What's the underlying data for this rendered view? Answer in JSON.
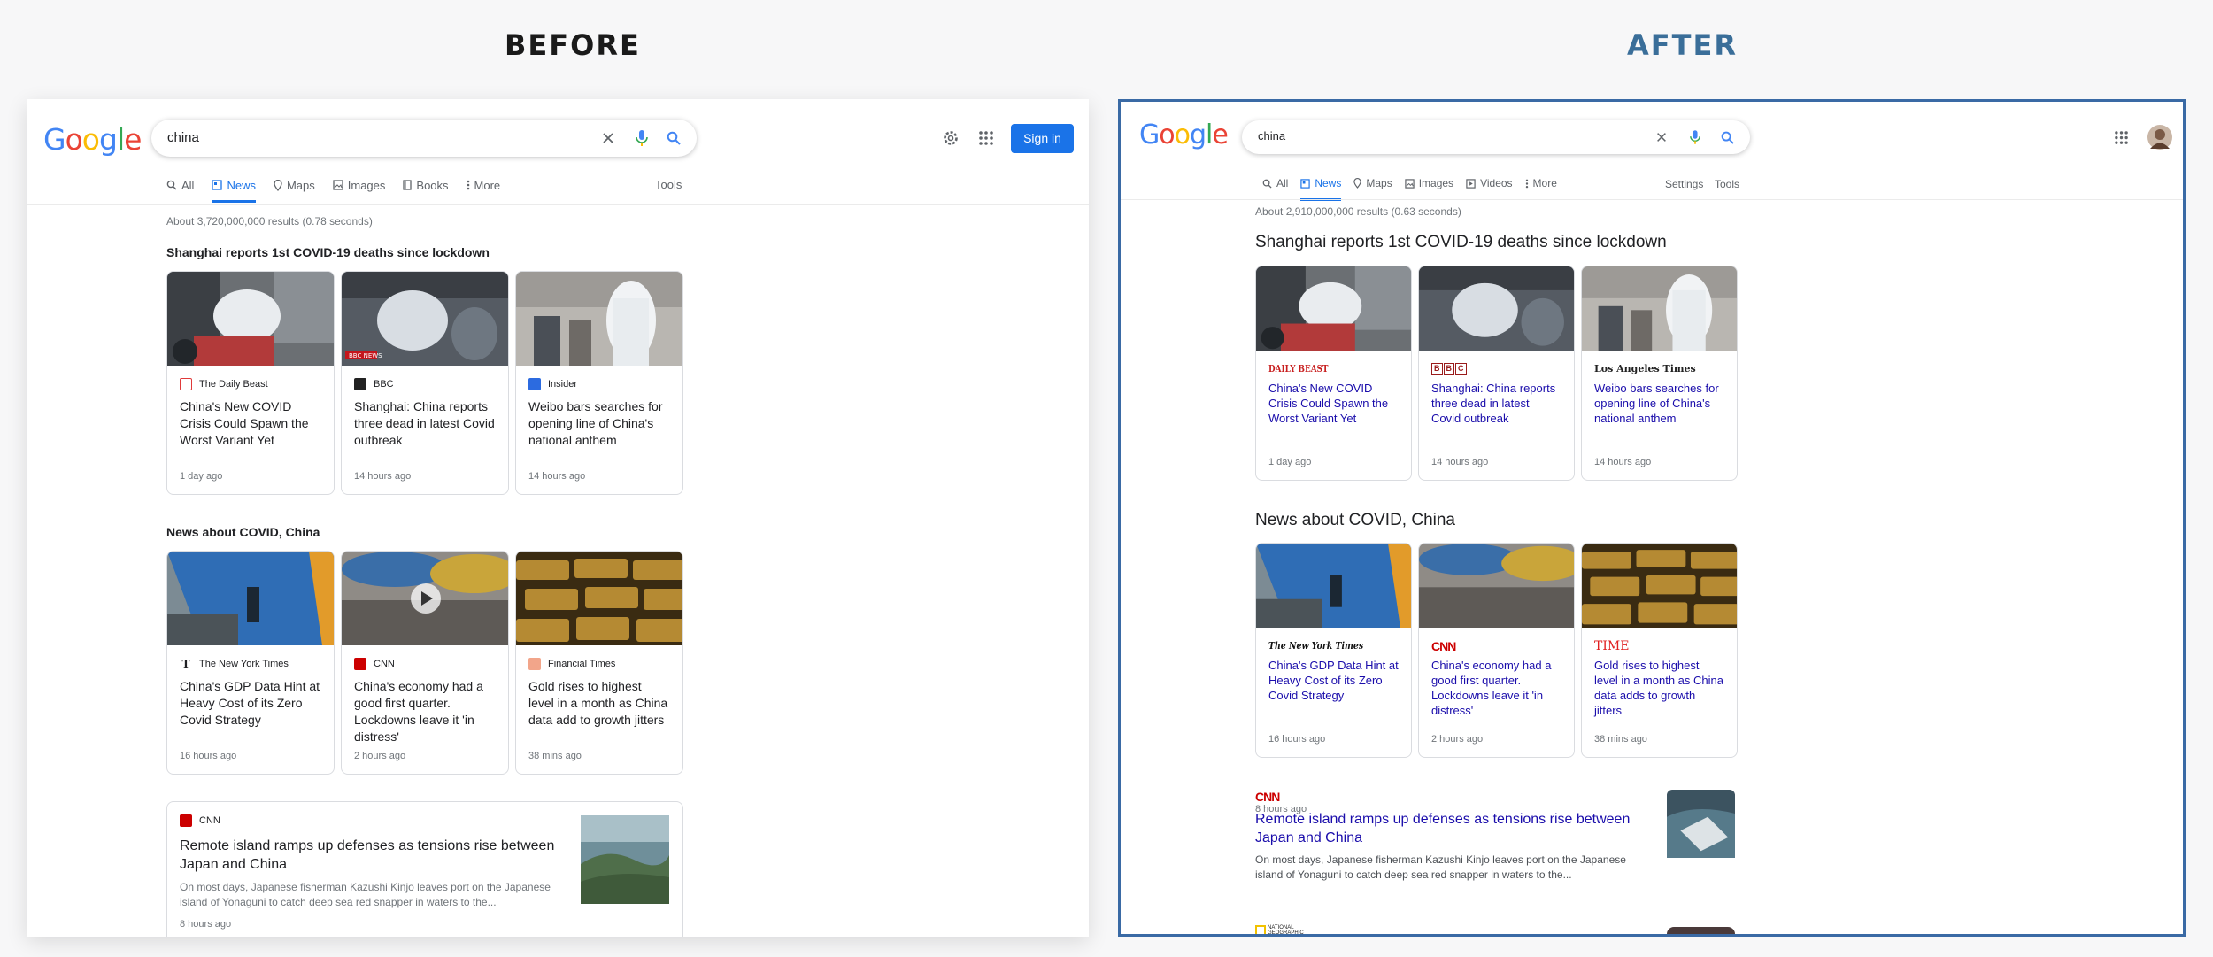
{
  "headings": {
    "before": "BEFORE",
    "after": "AFTER"
  },
  "before": {
    "logo": "Google",
    "query": "china",
    "tabs": [
      "All",
      "News",
      "Maps",
      "Images",
      "Books",
      "More"
    ],
    "tools": "Tools",
    "sign_in": "Sign in",
    "result_stats": "About 3,720,000,000 results (0.78 seconds)",
    "section1_title": "Shanghai reports 1st COVID-19 deaths since lockdown",
    "section1": [
      {
        "source": "The Daily Beast",
        "title": "China's New COVID Crisis Could Spawn the Worst Variant Yet",
        "time": "1 day ago",
        "fav_color": "#e03a3a"
      },
      {
        "source": "BBC",
        "title": "Shanghai: China reports three dead in latest Covid outbreak",
        "time": "14 hours ago",
        "fav_color": "#222222",
        "img_label": "BBC NEWS"
      },
      {
        "source": "Insider",
        "title": "Weibo bars searches for opening line of China's national anthem",
        "time": "14 hours ago",
        "fav_color": "#2c6be0"
      }
    ],
    "section2_title": "News about COVID, China",
    "section2": [
      {
        "source": "The New York Times",
        "title": "China's GDP Data Hint at Heavy Cost of its Zero Covid Strategy",
        "time": "16 hours ago",
        "fav_color": "#222222"
      },
      {
        "source": "CNN",
        "title": "China's economy had a good first quarter. Lockdowns leave it 'in distress'",
        "time": "2 hours ago",
        "fav_color": "#cc0000"
      },
      {
        "source": "Financial Times",
        "title": "Gold rises to highest level in a month as China data add to growth jitters",
        "time": "38 mins ago",
        "fav_color": "#f2a58a"
      }
    ],
    "article": {
      "source": "CNN",
      "title": "Remote island ramps up defenses as tensions rise between Japan and China",
      "snippet": "On most days, Japanese fisherman Kazushi Kinjo leaves port on the Japanese island of Yonaguni to catch deep sea red snapper in waters to the...",
      "time": "8 hours ago"
    }
  },
  "after": {
    "logo": "Google",
    "query": "china",
    "tabs": [
      "All",
      "News",
      "Maps",
      "Images",
      "Videos",
      "More"
    ],
    "settings": "Settings",
    "tools": "Tools",
    "result_stats": "About 2,910,000,000 results (0.63 seconds)",
    "section1_title": "Shanghai reports 1st COVID-19 deaths since lockdown",
    "section1": [
      {
        "brand": "DAILY BEAST",
        "title": "China's New COVID Crisis Could Spawn the Worst Variant Yet",
        "time": "1 day ago"
      },
      {
        "brand": "BBC",
        "title": "Shanghai: China reports three dead in latest Covid outbreak",
        "time": "14 hours ago"
      },
      {
        "brand": "Los Angeles Times",
        "title": "Weibo bars searches for opening line of China's national anthem",
        "time": "14 hours ago"
      }
    ],
    "section2_title": "News about COVID, China",
    "section2": [
      {
        "brand": "The New York Times",
        "title": "China's GDP Data Hint at Heavy Cost of its Zero Covid Strategy",
        "time": "16 hours ago"
      },
      {
        "brand": "CNN",
        "title": "China's economy had a good first quarter. Lockdowns leave it 'in distress'",
        "time": "2 hours ago"
      },
      {
        "brand": "TIME",
        "title": "Gold rises to highest level in a month as China data adds to growth jitters",
        "time": "38 mins ago"
      }
    ],
    "article": {
      "brand": "CNN",
      "title": "Remote island ramps up defenses as tensions rise between Japan and China",
      "snippet": "On most days, Japanese fisherman Kazushi Kinjo leaves port on the Japanese island of Yonaguni to catch deep sea red snapper in waters to the...",
      "time": "8 hours ago"
    },
    "next_brand": "NATIONAL GEOGRAPHIC"
  },
  "colors": {
    "link_blue": "#1a0dab",
    "accent": "#1a73e8",
    "after_border": "#3a6aa5",
    "after_heading": "#3a6e99"
  },
  "icons": [
    "search-icon",
    "clear-icon",
    "mic-icon",
    "settings-gear-icon",
    "apps-grid-icon",
    "play-icon",
    "avatar"
  ]
}
